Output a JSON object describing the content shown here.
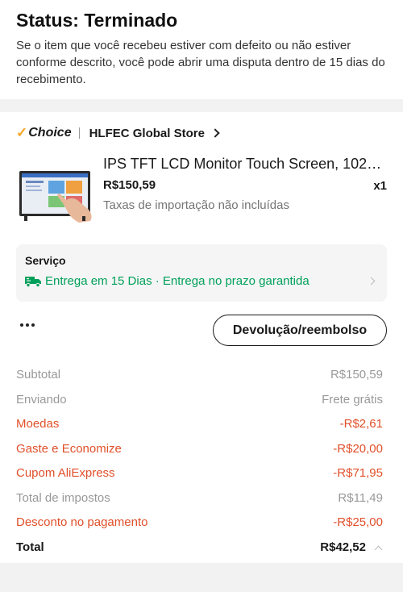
{
  "status": {
    "title": "Status: Terminado",
    "description": "Se o item que você recebeu estiver com defeito ou não estiver conforme descrito, você pode abrir uma disputa dentro de 15 dias do recebimento."
  },
  "store": {
    "badge": "Choice",
    "name": "HLFEC Global Store"
  },
  "product": {
    "title": "IPS TFT LCD Monitor Touch Screen, 1024...",
    "price": "R$150,59",
    "quantity": "x1",
    "tax_note": "Taxas de importação não incluídas"
  },
  "service": {
    "title": "Serviço",
    "delivery": "Entrega em 15 Dias · Entrega no prazo garantida"
  },
  "actions": {
    "refund_label": "Devolução/reembolso"
  },
  "summary": {
    "subtotal": {
      "label": "Subtotal",
      "value": "R$150,59"
    },
    "shipping": {
      "label": "Enviando",
      "value": "Frete grátis"
    },
    "coins": {
      "label": "Moedas",
      "value": "-R$2,61"
    },
    "spend_save": {
      "label": "Gaste e Economize",
      "value": "-R$20,00"
    },
    "coupon": {
      "label": "Cupom AliExpress",
      "value": "-R$71,95"
    },
    "taxes": {
      "label": "Total de impostos",
      "value": "R$11,49"
    },
    "payment_discount": {
      "label": "Desconto no pagamento",
      "value": "-R$25,00"
    },
    "total": {
      "label": "Total",
      "value": "R$42,52"
    }
  },
  "colors": {
    "discount": "#e0502a",
    "delivery_green": "#00a05a",
    "choice_check": "#f5a623"
  }
}
